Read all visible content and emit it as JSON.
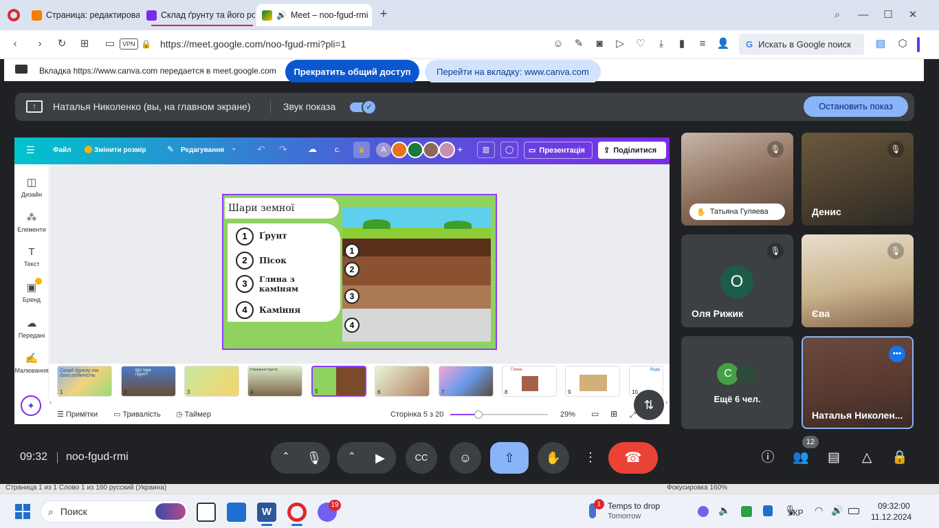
{
  "browser": {
    "tabs": [
      {
        "title": "Страница: редактирован"
      },
      {
        "title": "Склад ґрунту та його род"
      },
      {
        "title": "Meet – noo-fgud-rmi"
      }
    ],
    "new_tab": "+",
    "window_controls": [
      "—",
      "☐",
      "✕"
    ],
    "url": "https://meet.google.com/noo-fgud-rmi?pli=1",
    "vpn_label": "VPN",
    "search_box": "Искать в Google поиск"
  },
  "share_banner": {
    "text": "Вкладка https://www.canva.com передается в meet.google.com",
    "stop_button": "Прекратить общий доступ",
    "goto_button": "Перейти на вкладку: www.canva.com"
  },
  "presenting_bar": {
    "presenter": "Наталья Николенко (вы, на главном экране)",
    "audio_label": "Звук показа",
    "stop_button": "Остановить показ"
  },
  "canva": {
    "menu": [
      "Файл",
      "Змінити розмір",
      "Редагування"
    ],
    "letter_c": "с.",
    "avatar_a": "A",
    "presentation": "Презентація",
    "share": "Поділитися",
    "sidebar": [
      "Дизайн",
      "Елементи",
      "Текст",
      "Бренд",
      "Передані",
      "Малювання"
    ],
    "slide": {
      "title": "Шари земної поверхні",
      "items": [
        {
          "n": "1",
          "label": "Ґрунт"
        },
        {
          "n": "2",
          "label": "Пісок"
        },
        {
          "n": "3",
          "label": "Глина з каміням"
        },
        {
          "n": "4",
          "label": "Каміння"
        }
      ],
      "layers": [
        "1",
        "2",
        "3",
        "4"
      ]
    },
    "thumbnails": [
      {
        "n": "1",
        "text": "Склад ґрунту та його родючість"
      },
      {
        "n": "2",
        "text": "Що таке ґрунт?"
      },
      {
        "n": "3",
        "text": ""
      },
      {
        "n": "4",
        "text": "Утворення ґрунту"
      },
      {
        "n": "5",
        "text": ""
      },
      {
        "n": "6",
        "text": ""
      },
      {
        "n": "7",
        "text": ""
      },
      {
        "n": "8",
        "text": "Глина"
      },
      {
        "n": "9",
        "text": ""
      },
      {
        "n": "10",
        "text": "Вода"
      }
    ],
    "footer": {
      "notes": "Примітки",
      "duration": "Тривалість",
      "timer": "Таймер",
      "page": "Сторінка 5 з 20",
      "zoom": "29%",
      "zoom_level": 0.29
    }
  },
  "participants": [
    {
      "name": "Татьяна Гуляева",
      "muted": true
    },
    {
      "name": "Денис",
      "muted": true
    },
    {
      "name": "Оля Рижик",
      "initial": "О",
      "muted": true
    },
    {
      "name": "Єва",
      "muted": true
    },
    {
      "name": "Ещё 6 чел.",
      "initial": "С"
    },
    {
      "name": "Наталья Николен..."
    }
  ],
  "meeting": {
    "time": "09:32",
    "code": "noo-fgud-rmi",
    "people_count": "12"
  },
  "statusline": {
    "text": "Страница 1 из 1      Слово 1 из 160      русский (Украина)",
    "right": "Фокусировка                160%"
  },
  "taskbar": {
    "search": "Поиск",
    "badge_viber": "19",
    "weather_badge": "1",
    "weather_title": "Temps to drop",
    "weather_sub": "Tomorrow",
    "lang": "УКР",
    "time": "09:32:00",
    "date": "11.12.2024"
  },
  "colors": {
    "meet_bg": "#202124",
    "accent_blue": "#8ab4f8",
    "end_call": "#ea4335",
    "share_btn": "#0b57d0"
  }
}
